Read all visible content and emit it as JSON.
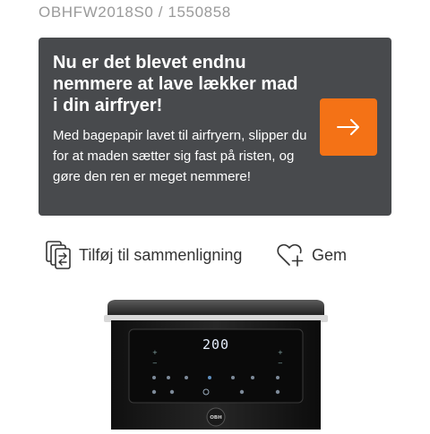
{
  "product": {
    "sku_line": "OBHFW2018S0 / 1550858",
    "display_value": "200",
    "image_alt": "Airfryer",
    "brand_badge": "OBH"
  },
  "promo": {
    "title": "Nu er det blevet endnu nemmere at lave lækker mad i din airfryer!",
    "text": "Med bagepapir lavet til airfryern, slipper du for at maden sætter sig fast på risten, og gøre den ren er meget nemmere!",
    "button_icon": "arrow-right-icon",
    "colors": {
      "background": "#484a4d",
      "button": "#f47216"
    }
  },
  "actions": {
    "compare_label": "Tilføj til sammenligning",
    "compare_icon": "compare-icon",
    "save_label": "Gem",
    "save_icon": "heart-plus-icon"
  }
}
